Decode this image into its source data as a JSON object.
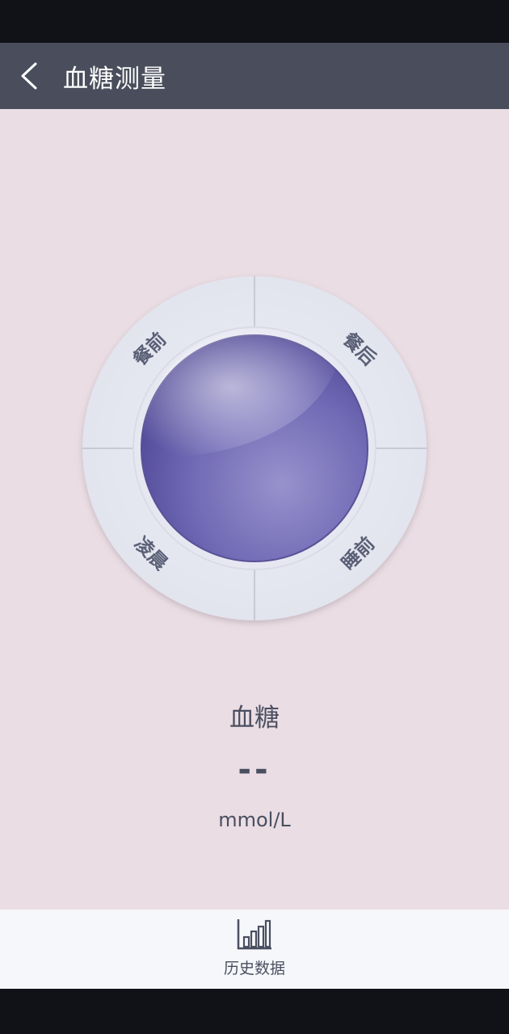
{
  "header": {
    "title": "血糖测量",
    "back_icon": "chevron-left-icon"
  },
  "dial": {
    "segments": [
      {
        "label": "餐前",
        "position": "top-left"
      },
      {
        "label": "餐后",
        "position": "top-right"
      },
      {
        "label": "凌晨",
        "position": "bottom-left"
      },
      {
        "label": "睡前",
        "position": "bottom-right"
      }
    ],
    "center_button_color": "#7068b3"
  },
  "reading": {
    "title": "血糖",
    "value": "--",
    "unit": "mmol/L"
  },
  "bottom_nav": {
    "history_label": "历史数据",
    "history_icon": "bar-chart-icon"
  },
  "colors": {
    "header_bg": "#4a4e5c",
    "content_bg": "#eadde3",
    "text": "#4a4f60"
  }
}
